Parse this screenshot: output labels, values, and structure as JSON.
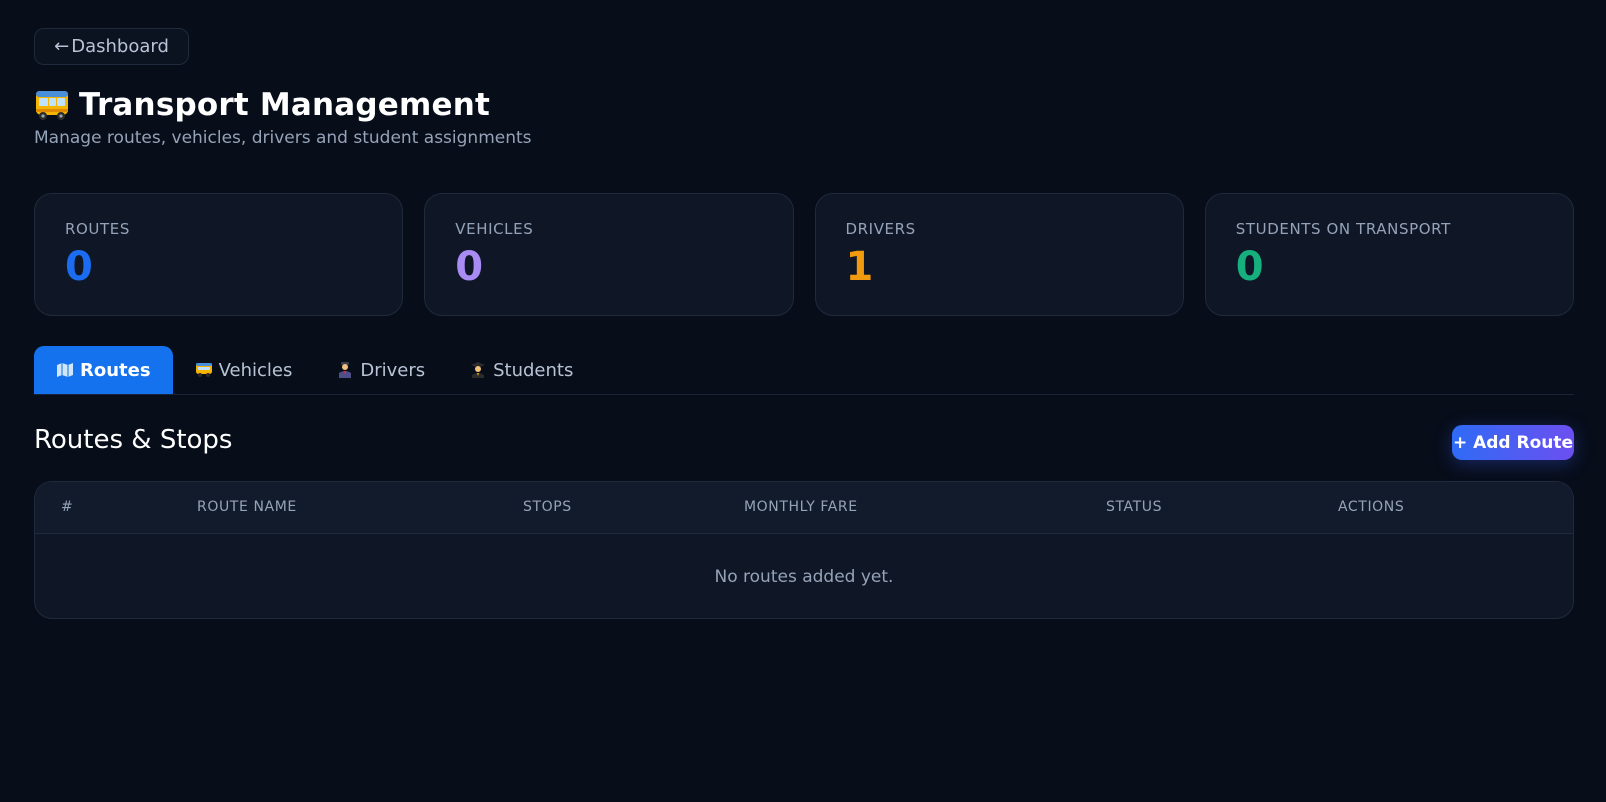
{
  "nav": {
    "back_arrow": "←",
    "back_label": "Dashboard"
  },
  "header": {
    "icon": "bus-icon",
    "title": "Transport Management",
    "subtitle": "Manage routes, vehicles, drivers and student assignments"
  },
  "stats": [
    {
      "label": "ROUTES",
      "value": "0",
      "color": "#1c6cf2"
    },
    {
      "label": "VEHICLES",
      "value": "0",
      "color": "#a98bf4"
    },
    {
      "label": "DRIVERS",
      "value": "1",
      "color": "#f19a0e"
    },
    {
      "label": "STUDENTS ON TRANSPORT",
      "value": "0",
      "color": "#16b07f"
    }
  ],
  "tabs": [
    {
      "label": "Routes",
      "icon": "map-icon",
      "active": true
    },
    {
      "label": "Vehicles",
      "icon": "bus-icon",
      "active": false
    },
    {
      "label": "Drivers",
      "icon": "driver-icon",
      "active": false
    },
    {
      "label": "Students",
      "icon": "student-icon",
      "active": false
    }
  ],
  "section": {
    "title": "Routes & Stops",
    "add_button": "+ Add Route"
  },
  "table": {
    "columns": [
      "#",
      "ROUTE NAME",
      "STOPS",
      "MONTHLY FARE",
      "STATUS",
      "ACTIONS"
    ],
    "empty_message": "No routes added yet."
  },
  "colors": {
    "background": "#070d19",
    "card": "#0f1726",
    "accent": "#1472ef",
    "add_gradient_start": "#2f6bf5",
    "add_gradient_end": "#6c4ff0"
  }
}
